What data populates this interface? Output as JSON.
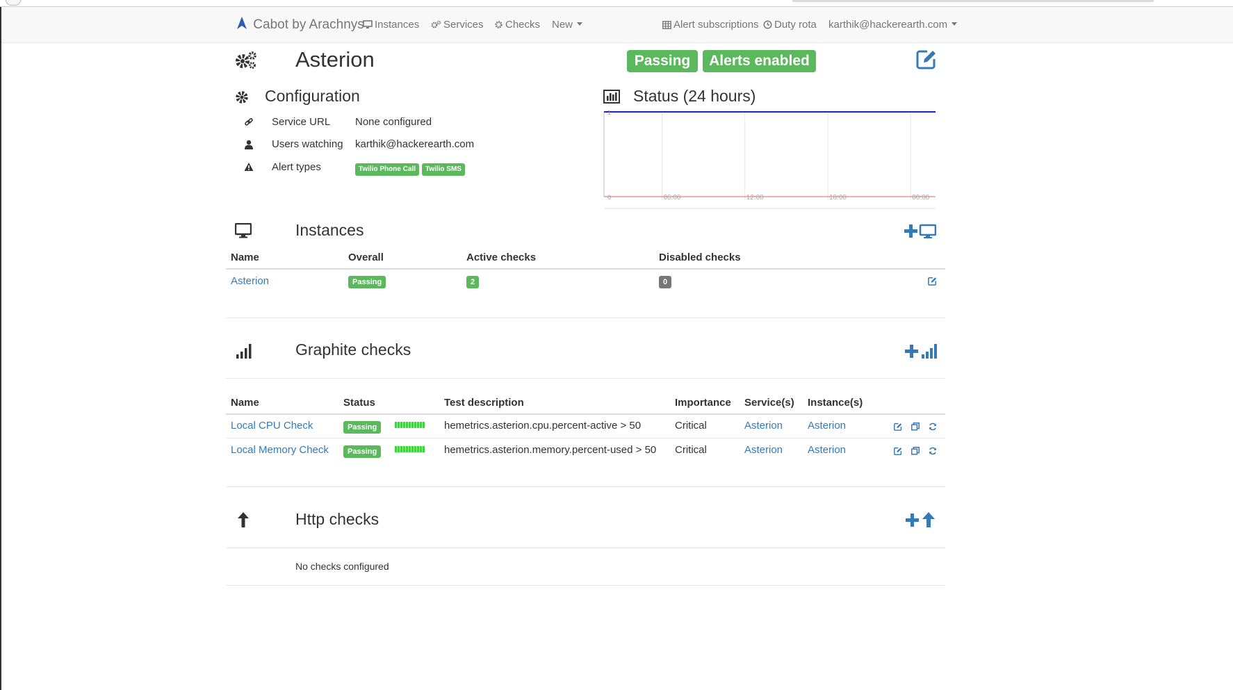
{
  "nav": {
    "brand": "Cabot by Arachnys",
    "instances": "Instances",
    "services": "Services",
    "checks": "Checks",
    "new": "New",
    "alert_subscriptions": "Alert subscriptions",
    "duty_rota": "Duty rota",
    "user": "karthik@hackerearth.com"
  },
  "service": {
    "name": "Asterion",
    "status_badge": "Passing",
    "alerts_badge": "Alerts enabled"
  },
  "config": {
    "title": "Configuration",
    "rows": [
      {
        "label": "Service URL",
        "value": "None configured",
        "icon": "link-icon"
      },
      {
        "label": "Users watching",
        "value": "karthik@hackerearth.com",
        "icon": "user-icon"
      },
      {
        "label": "Alert types",
        "icon": "warning-icon",
        "tags": [
          "Twilio Phone Call",
          "Twilio SMS"
        ]
      }
    ]
  },
  "status_chart": {
    "title": "Status (24 hours)"
  },
  "chart_data": {
    "type": "line",
    "title": "Status (24 hours)",
    "x_ticks": [
      "06:00",
      "12:00",
      "18:00",
      "00:00"
    ],
    "y_ticks": [
      "0",
      "1"
    ],
    "ylim": [
      0,
      1
    ],
    "series": [
      {
        "color": "#1f1fcc",
        "values": [
          1,
          1,
          1,
          1,
          1
        ]
      },
      {
        "color": "#e06060",
        "values": [
          0,
          0,
          0,
          0,
          0
        ]
      }
    ],
    "grid": true
  },
  "instances": {
    "title": "Instances",
    "headers": [
      "Name",
      "Overall",
      "Active checks",
      "Disabled checks"
    ],
    "rows": [
      {
        "name": "Asterion",
        "overall": "Passing",
        "active": "2",
        "disabled": "0"
      }
    ]
  },
  "graphite": {
    "title": "Graphite checks",
    "headers": [
      "Name",
      "Status",
      "Test description",
      "Importance",
      "Service(s)",
      "Instance(s)"
    ],
    "rows": [
      {
        "name": "Local CPU Check",
        "status": "Passing",
        "description": "hemetrics.asterion.cpu.percent-active > 50",
        "importance": "Critical",
        "service": "Asterion",
        "instance": "Asterion"
      },
      {
        "name": "Local Memory Check",
        "status": "Passing",
        "description": "hemetrics.asterion.memory.percent-used > 50",
        "importance": "Critical",
        "service": "Asterion",
        "instance": "Asterion"
      }
    ]
  },
  "http": {
    "title": "Http checks",
    "empty_text": "No checks configured"
  },
  "colors": {
    "accent": "#337ab7",
    "success": "#5cb85c",
    "muted": "#777777"
  }
}
